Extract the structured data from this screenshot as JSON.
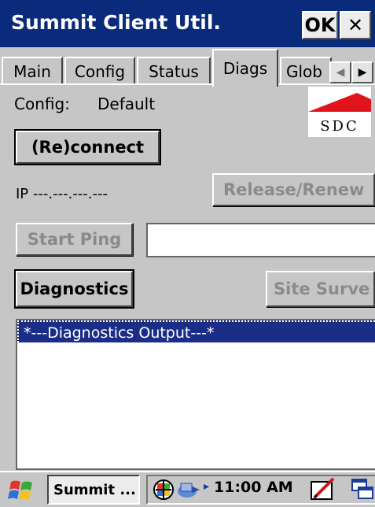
{
  "window": {
    "title": "Summit Client Util.",
    "ok_label": "OK",
    "close_label": "✕"
  },
  "tabs": [
    {
      "label": "Main",
      "active": false
    },
    {
      "label": "Config",
      "active": false
    },
    {
      "label": "Status",
      "active": false
    },
    {
      "label": "Diags",
      "active": true
    },
    {
      "label": "Glob",
      "active": false
    }
  ],
  "tab_scroll": {
    "left": "◀",
    "right": "▶"
  },
  "config": {
    "label": "Config:",
    "value": "Default"
  },
  "logo": {
    "text": "SDC",
    "color": "#e2141b"
  },
  "buttons": {
    "reconnect": "(Re)connect",
    "release_renew": "Release/Renew",
    "start_ping": "Start Ping",
    "diagnostics": "Diagnostics",
    "site_survey": "Site Surve"
  },
  "ip": {
    "text": "IP ---.---.---.---"
  },
  "ping_input": {
    "value": ""
  },
  "output": {
    "lines": [
      "*---Diagnostics Output---*"
    ]
  },
  "taskbar": {
    "app_button": "Summit ...",
    "clock": "11:00 AM",
    "tray_arrow": "▸"
  },
  "colors": {
    "titlebar": "#0a2b7c",
    "selection": "#1c2d88",
    "background": "#c6c6c6"
  }
}
